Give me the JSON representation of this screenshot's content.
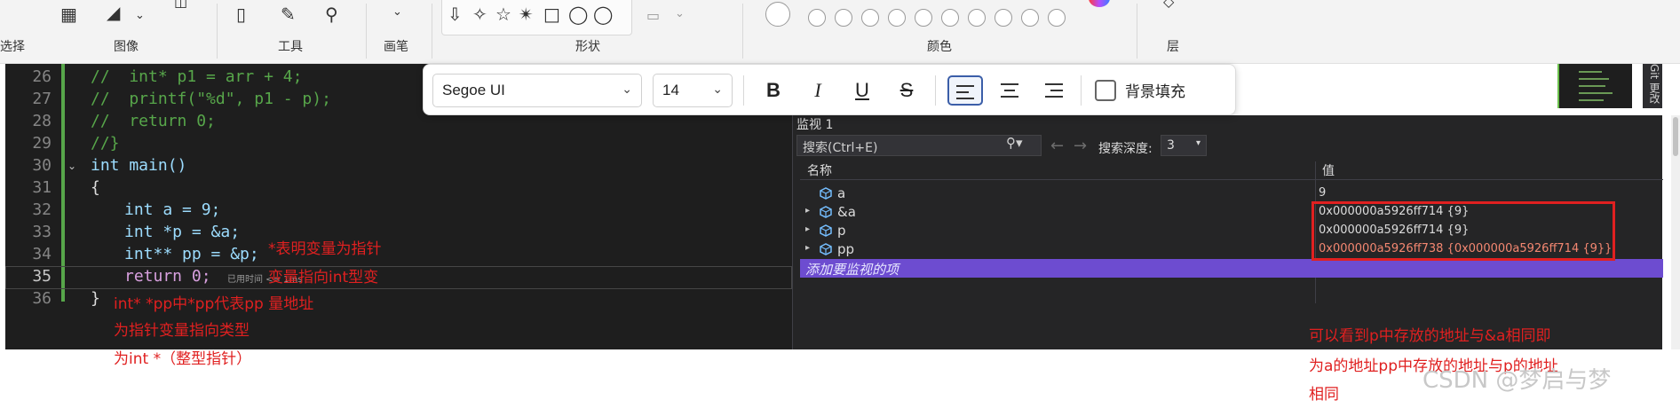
{
  "ribbon": {
    "groups": [
      "选择",
      "图像",
      "工具",
      "画笔",
      "形状",
      "颜色",
      "层"
    ]
  },
  "format_toolbar": {
    "font_family": "Segoe UI",
    "font_size": "14",
    "bold": "B",
    "italic": "I",
    "underline": "U",
    "strike": "S",
    "fill_label": "背景填充"
  },
  "editor": {
    "lines": [
      {
        "num": "26",
        "text": "//  int* p1 = arr + 4;"
      },
      {
        "num": "27",
        "text": "//  printf(\"%d\", p1 - p);"
      },
      {
        "num": "28",
        "text": "//  return 0;"
      },
      {
        "num": "29",
        "text": "//}"
      },
      {
        "num": "30",
        "text": "int main()"
      },
      {
        "num": "31",
        "text": "{"
      },
      {
        "num": "32",
        "text": "int a = 9;"
      },
      {
        "num": "33",
        "text": "int *p = &a;"
      },
      {
        "num": "34",
        "text": "int** pp = &p;"
      },
      {
        "num": "35",
        "text": "return 0;"
      },
      {
        "num": "36",
        "text": "}"
      }
    ],
    "elapsed": "已用时间 <= 1ms"
  },
  "watch": {
    "title": "监视 1",
    "search_placeholder": "搜索(Ctrl+E)",
    "depth_label": "搜索深度:",
    "depth_value": "3",
    "col_name": "名称",
    "col_value": "值",
    "rows": [
      {
        "name": "a",
        "value": "9",
        "expandable": false,
        "changed": false
      },
      {
        "name": "&a",
        "value": "0x000000a5926ff714 {9}",
        "expandable": true,
        "changed": false
      },
      {
        "name": "p",
        "value": "0x000000a5926ff714 {9}",
        "expandable": true,
        "changed": false
      },
      {
        "name": "pp",
        "value": "0x000000a5926ff738 {0x000000a5926ff714 {9}}",
        "expandable": true,
        "changed": true
      }
    ],
    "add_item": "添加要监视的项"
  },
  "side_tab": "Git 更改",
  "annotations": {
    "star_note_1": "*表明变量为指针",
    "star_note_2": "变量指向int型变",
    "pp_note_1": "int* *pp中*pp代表pp 量地址",
    "pp_note_2": "为指针变量指向类型",
    "pp_note_3": "为int *（整型指针）",
    "right_note_1": "可以看到p中存放的地址与&a相同即",
    "right_note_2": "为a的地址pp中存放的地址与p的地址",
    "right_note_3": "相同"
  },
  "watermark": "CSDN @梦启与梦",
  "colors": {
    "annotation": "#e02020",
    "add_row": "#6d4cd0",
    "changed_value": "#f48771"
  }
}
